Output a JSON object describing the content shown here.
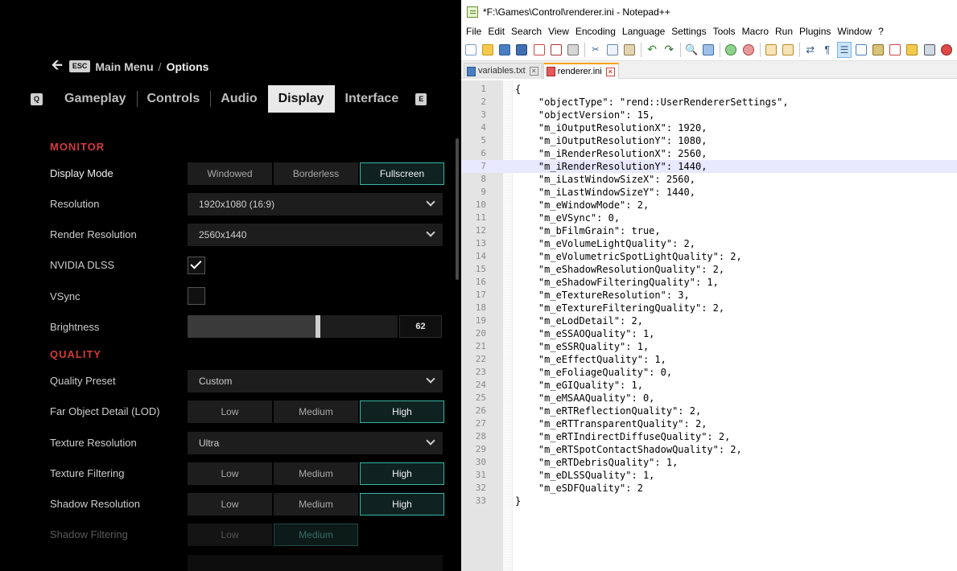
{
  "game": {
    "back_key": "ESC",
    "breadcrumb_parent": "Main Menu",
    "breadcrumb_sep": "/",
    "breadcrumb_current": "Options",
    "tab_left_key": "Q",
    "tab_right_key": "E",
    "tabs": [
      "Gameplay",
      "Controls",
      "Audio",
      "Display",
      "Interface"
    ],
    "active_tab": "Display",
    "sections": {
      "monitor": "MONITOR",
      "quality": "QUALITY"
    },
    "display_mode": {
      "label": "Display Mode",
      "options": [
        "Windowed",
        "Borderless",
        "Fullscreen"
      ],
      "selected": "Fullscreen"
    },
    "resolution": {
      "label": "Resolution",
      "value": "1920x1080 (16:9)"
    },
    "render_resolution": {
      "label": "Render Resolution",
      "value": "2560x1440"
    },
    "dlss": {
      "label": "NVIDIA DLSS",
      "checked": true
    },
    "vsync": {
      "label": "VSync",
      "checked": false
    },
    "brightness": {
      "label": "Brightness",
      "value": "62",
      "fill_fraction": 0.62
    },
    "quality_preset": {
      "label": "Quality Preset",
      "value": "Custom"
    },
    "lod": {
      "label": "Far Object Detail (LOD)",
      "options": [
        "Low",
        "Medium",
        "High"
      ],
      "selected": "High"
    },
    "texture_resolution": {
      "label": "Texture Resolution",
      "value": "Ultra"
    },
    "texture_filtering": {
      "label": "Texture Filtering",
      "options": [
        "Low",
        "Medium",
        "High"
      ],
      "selected": "High"
    },
    "shadow_resolution": {
      "label": "Shadow Resolution",
      "options": [
        "Low",
        "Medium",
        "High"
      ],
      "selected": "High"
    },
    "shadow_filtering": {
      "label": "Shadow Filtering",
      "options": [
        "Low",
        "Medium"
      ],
      "selected": "Medium"
    },
    "accent_color": "#36b5a6",
    "section_color": "#d23b3b"
  },
  "npp": {
    "title": "*F:\\Games\\Control\\renderer.ini - Notepad++",
    "menu": [
      "File",
      "Edit",
      "Search",
      "View",
      "Encoding",
      "Language",
      "Settings",
      "Tools",
      "Macro",
      "Run",
      "Plugins",
      "Window",
      "?"
    ],
    "tabs": [
      {
        "name": "variables.txt",
        "active": false
      },
      {
        "name": "renderer.ini",
        "active": true
      }
    ],
    "current_line": 7,
    "lines": [
      "{",
      "    \"objectType\": \"rend::UserRendererSettings\",",
      "    \"objectVersion\": 15,",
      "    \"m_iOutputResolutionX\": 1920,",
      "    \"m_iOutputResolutionY\": 1080,",
      "    \"m_iRenderResolutionX\": 2560,",
      "    \"m_iRenderResolutionY\": 1440,",
      "    \"m_iLastWindowSizeX\": 2560,",
      "    \"m_iLastWindowSizeY\": 1440,",
      "    \"m_eWindowMode\": 2,",
      "    \"m_eVSync\": 0,",
      "    \"m_bFilmGrain\": true,",
      "    \"m_eVolumeLightQuality\": 2,",
      "    \"m_eVolumetricSpotLightQuality\": 2,",
      "    \"m_eShadowResolutionQuality\": 2,",
      "    \"m_eShadowFilteringQuality\": 1,",
      "    \"m_eTextureResolution\": 3,",
      "    \"m_eTextureFilteringQuality\": 2,",
      "    \"m_eLodDetail\": 2,",
      "    \"m_eSSAOQuality\": 1,",
      "    \"m_eSSRQuality\": 1,",
      "    \"m_eEffectQuality\": 1,",
      "    \"m_eFoliageQuality\": 0,",
      "    \"m_eGIQuality\": 1,",
      "    \"m_eMSAAQuality\": 0,",
      "    \"m_eRTReflectionQuality\": 2,",
      "    \"m_eRTTransparentQuality\": 2,",
      "    \"m_eRTIndirectDiffuseQuality\": 2,",
      "    \"m_eRTSpotContactShadowQuality\": 2,",
      "    \"m_eRTDebrisQuality\": 1,",
      "    \"m_eDLSSQuality\": 1,",
      "    \"m_eSDFQuality\": 2",
      "}"
    ],
    "toolbar_icons": [
      "new-icon",
      "open-icon",
      "save-icon",
      "save-all-icon",
      "close-icon",
      "close-all-icon",
      "print-icon",
      "cut-icon",
      "copy-icon",
      "paste-icon",
      "undo-icon",
      "redo-icon",
      "find-icon",
      "replace-icon",
      "zoom-in-icon",
      "zoom-out-icon",
      "sync-v-icon",
      "sync-h-icon",
      "word-wrap-icon",
      "show-all-chars-icon",
      "indent-guide-icon",
      "udl-icon",
      "doc-map-icon",
      "function-list-icon",
      "folder-workspace-icon",
      "monitor-icon",
      "record-icon"
    ]
  }
}
